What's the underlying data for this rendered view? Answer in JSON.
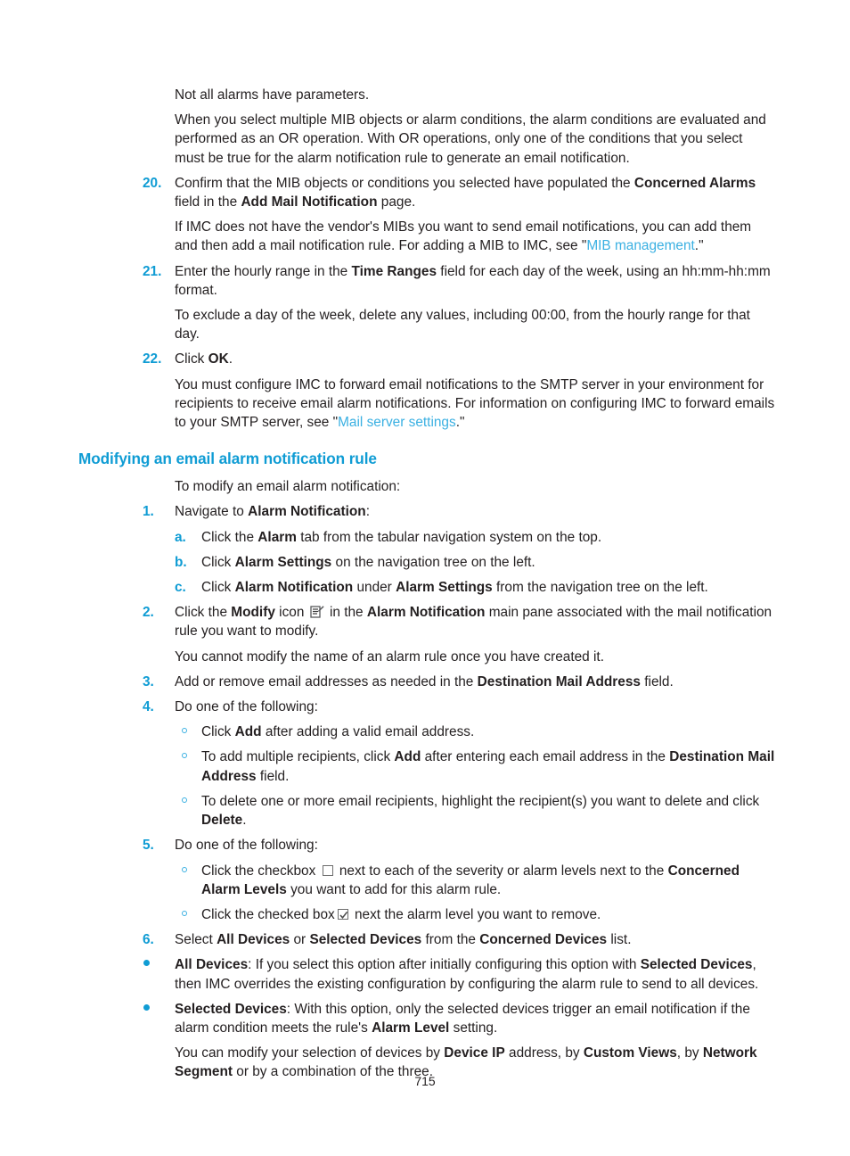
{
  "document": {
    "page_number": "715",
    "colors": {
      "heading": "#0f9cd4",
      "link": "#3ab0e2",
      "marker": "#0f9cd4",
      "body": "#231f20"
    }
  },
  "blocks": {
    "note_not_all_alarms": "Not all alarms have parameters.",
    "note_or_operation": "When you select multiple MIB objects or alarm conditions, the alarm conditions are evaluated and performed as an OR operation. With OR operations, only one of the conditions that you select must be true for the alarm notification rule to generate an email notification.",
    "step20": {
      "marker": "20.",
      "t1": "Confirm that the MIB objects or conditions you selected have populated the ",
      "b1": "Concerned Alarms",
      "t2": " field in the ",
      "b2": "Add Mail Notification",
      "t3": " page."
    },
    "note_mib_vendor": {
      "t1": "If IMC does not have the vendor's MIBs you want to send email notifications, you can add them and then add a mail notification rule. For adding a MIB to IMC, see \"",
      "link": "MIB management",
      "t2": ".\""
    },
    "step21": {
      "marker": "21.",
      "t1": "Enter the hourly range in the ",
      "b1": "Time Ranges",
      "t2": " field for each day of the week, using an hh:mm-hh:mm format."
    },
    "note_exclude_day": "To exclude a day of the week, delete any values, including 00:00, from the hourly range for that day.",
    "step22": {
      "marker": "22.",
      "t1": "Click ",
      "b1": "OK",
      "t2": "."
    },
    "note_smtp": {
      "t1": "You must configure IMC to forward email notifications to the SMTP server in your environment for recipients to receive email alarm notifications. For information on configuring IMC to forward emails to your SMTP server, see \"",
      "link": "Mail server settings",
      "t2": ".\""
    },
    "heading_modifying": "Modifying an email alarm notification rule",
    "intro_modify": "To modify an email alarm notification:",
    "step1": {
      "marker": "1.",
      "t1": "Navigate to ",
      "b1": "Alarm Notification",
      "t2": ":"
    },
    "step1a": {
      "marker": "a.",
      "t1": "Click the ",
      "b1": "Alarm",
      "t2": " tab from the tabular navigation system on the top."
    },
    "step1b": {
      "marker": "b.",
      "t1": "Click ",
      "b1": "Alarm Settings",
      "t2": " on the navigation tree on the left."
    },
    "step1c": {
      "marker": "c.",
      "t1": "Click ",
      "b1": "Alarm Notification",
      "t2": " under ",
      "b2": "Alarm Settings",
      "t3": " from the navigation tree on the left."
    },
    "step2": {
      "marker": "2.",
      "t1": "Click the ",
      "b1": "Modify",
      "t2": " icon ",
      "icon": "modify-icon",
      "t3": " in the ",
      "b2": "Alarm Notification",
      "t4": " main pane associated with the mail notification rule you want to modify."
    },
    "note_cannot_modify": "You cannot modify the name of an alarm rule once you have created it.",
    "step3": {
      "marker": "3.",
      "t1": "Add or remove email addresses as needed in the ",
      "b1": "Destination Mail Address",
      "t2": " field."
    },
    "step4": {
      "marker": "4.",
      "t1": "Do one of the following:"
    },
    "step4_b1": {
      "t1": "Click ",
      "b1": "Add",
      "t2": " after adding a valid email address."
    },
    "step4_b2": {
      "t1": "To add multiple recipients, click ",
      "b1": "Add",
      "t2": " after entering each email address in the ",
      "b2": "Destination Mail Address",
      "t3": " field."
    },
    "step4_b3": {
      "t1": "To delete one or more email recipients, highlight the recipient(s) you want to delete and click ",
      "b1": "Delete",
      "t2": "."
    },
    "step5": {
      "marker": "5.",
      "t1": "Do one of the following:"
    },
    "step5_b1": {
      "t1": "Click the checkbox ",
      "icon": "checkbox-empty-icon",
      "t2": " next to each of the severity or alarm levels next to the ",
      "b1": "Concerned Alarm Levels",
      "t3": " you want to add for this alarm rule."
    },
    "step5_b2": {
      "t1": "Click the checked box",
      "icon": "checkbox-checked-icon",
      "t2": " next the alarm level you want to remove."
    },
    "step6": {
      "marker": "6.",
      "t1": "Select ",
      "b1": "All Devices",
      "t2": " or ",
      "b2": "Selected Devices",
      "t3": " from the ",
      "b3": "Concerned Devices",
      "t4": " list."
    },
    "bullet_all_devices": {
      "b1": "All Devices",
      "t1": ": If you select this option after initially configuring this option with ",
      "b2": "Selected Devices",
      "t2": ", then IMC overrides the existing configuration by configuring the alarm rule to send to all devices."
    },
    "bullet_selected_devices": {
      "b1": "Selected Devices",
      "t1": ": With this option, only the selected devices trigger an email notification if the alarm condition meets the rule's ",
      "b2": "Alarm Level",
      "t2": " setting."
    },
    "note_modify_selection": {
      "t1": "You can modify your selection of devices by ",
      "b1": "Device IP",
      "t2": " address, by ",
      "b2": "Custom Views",
      "t3": ", by ",
      "b3": "Network Segment",
      "t4": " or by a combination of the three."
    }
  }
}
